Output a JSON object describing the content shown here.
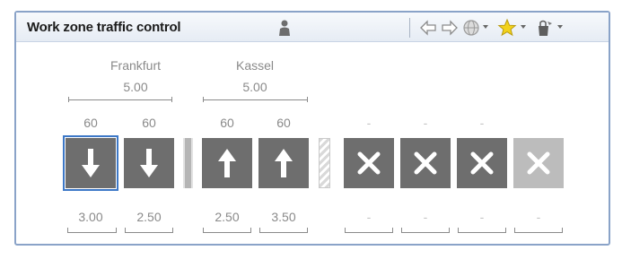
{
  "header": {
    "title": "Work zone traffic control"
  },
  "groups": [
    {
      "name": "Frankfurt",
      "value": "5.00"
    },
    {
      "name": "Kassel",
      "value": "5.00"
    }
  ],
  "lanes": [
    {
      "speed": "60",
      "icon": "arrow-down-icon",
      "width": "3.00",
      "state": "selected"
    },
    {
      "speed": "60",
      "icon": "arrow-down-icon",
      "width": "2.50",
      "state": "normal"
    },
    {
      "speed": "60",
      "icon": "arrow-up-icon",
      "width": "2.50",
      "state": "normal"
    },
    {
      "speed": "60",
      "icon": "arrow-up-icon",
      "width": "3.50",
      "state": "normal"
    },
    {
      "speed": "-",
      "icon": "x-icon",
      "width": "-",
      "state": "normal"
    },
    {
      "speed": "-",
      "icon": "x-icon",
      "width": "-",
      "state": "normal"
    },
    {
      "speed": "-",
      "icon": "x-icon",
      "width": "-",
      "state": "normal"
    },
    {
      "speed": "",
      "icon": "x-icon",
      "width": "-",
      "state": "disabled"
    }
  ],
  "colors": {
    "lane": "#6e6e6e",
    "lane_disabled": "#bcbcbc",
    "selection": "#3d78c7",
    "border": "#8aa3c8",
    "star": "#f2d21b"
  }
}
